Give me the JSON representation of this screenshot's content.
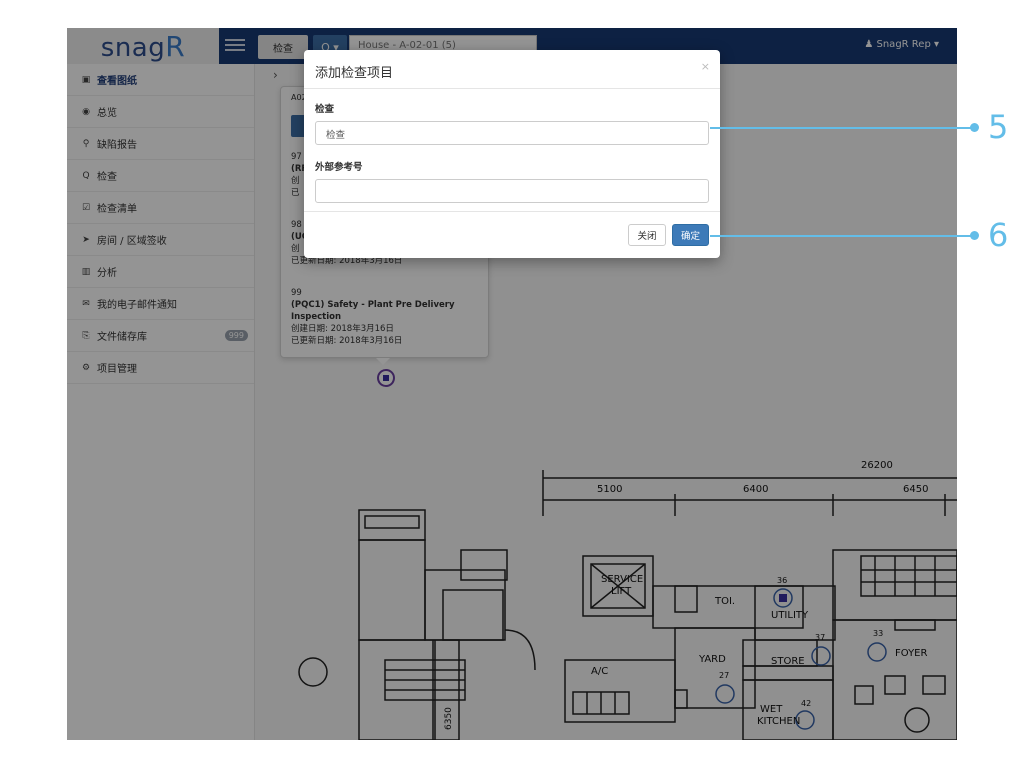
{
  "topbar": {
    "logo": "snag",
    "logo_r": "R",
    "search_scope": "检查",
    "search_btn": "Q ▾",
    "search_value": "House - A-02-01 (5)",
    "user": "SnagR Rep ▾"
  },
  "sidebar": {
    "items": [
      {
        "icon": "▣",
        "label": "查看图纸"
      },
      {
        "icon": "◉",
        "label": "总览"
      },
      {
        "icon": "⚲",
        "label": "缺陷报告"
      },
      {
        "icon": "Q",
        "label": "检查"
      },
      {
        "icon": "☑",
        "label": "检查清单"
      },
      {
        "icon": "➤",
        "label": "房间 / 区域签收"
      },
      {
        "icon": "▥",
        "label": "分析"
      },
      {
        "icon": "✉",
        "label": "我的电子邮件通知"
      },
      {
        "icon": "⎘",
        "label": "文件储存库",
        "badge": "999"
      },
      {
        "icon": "⚙",
        "label": "项目管理"
      }
    ]
  },
  "popover": {
    "header": "A02",
    "items": [
      {
        "num": "97",
        "name": "(RF",
        "created": "创",
        "updated": "已"
      },
      {
        "num": "98",
        "name": "(UC",
        "created": "创",
        "updated": "已更新日期: 2018年3月16日"
      },
      {
        "num": "99",
        "name": "(PQC1) Safety - Plant Pre Delivery Inspection",
        "created": "创建日期: 2018年3月16日",
        "updated": "已更新日期: 2018年3月16日"
      }
    ]
  },
  "plan": {
    "dims_total": "26200",
    "dims": [
      "5100",
      "6400",
      "6450"
    ],
    "rooms": [
      "SERVICE",
      "LIFT",
      "TOI.",
      "UTILITY",
      "YARD",
      "STORE",
      "FOYER",
      "A/C",
      "WET",
      "KITCHEN"
    ],
    "markers": [
      "36",
      "37",
      "33",
      "27",
      "42"
    ],
    "vert_dim": "6350"
  },
  "modal": {
    "title": "添加检查项目",
    "close_x": "×",
    "field1_label": "检查",
    "field1_value": "检查",
    "field2_label": "外部参考号",
    "field2_value": "",
    "btn_close": "关闭",
    "btn_ok": "确定"
  },
  "callouts": [
    "5",
    "6"
  ]
}
